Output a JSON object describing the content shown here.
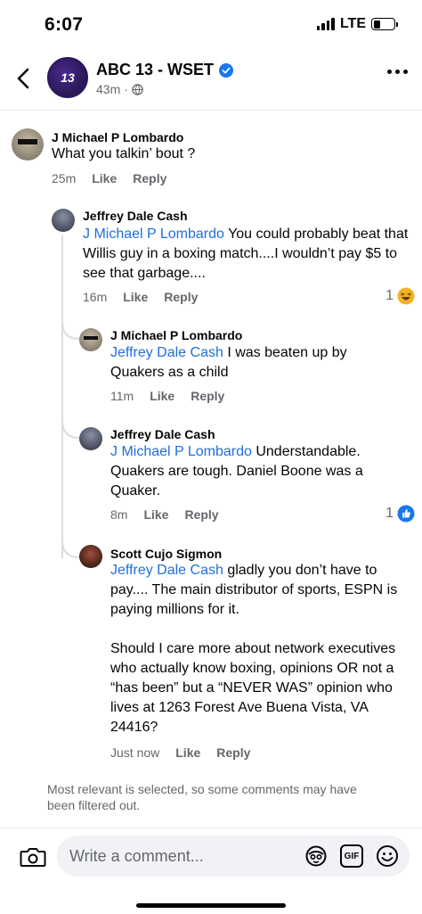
{
  "status_bar": {
    "time": "6:07",
    "network": "LTE",
    "battery_level": 0.35
  },
  "header": {
    "page_name": "ABC 13 - WSET",
    "post_time": "43m",
    "avatar_text": "13"
  },
  "comments": [
    {
      "author": "J Michael P Lombardo",
      "text": "What you talkin’ bout ?",
      "time": "25m",
      "like": "Like",
      "reply": "Reply"
    },
    {
      "author": "Jeffrey Dale Cash",
      "mention": "J Michael P Lombardo",
      "text": " You could probably beat that Willis guy in a boxing match....I wouldn’t pay $5 to see that garbage....",
      "time": "16m",
      "like": "Like",
      "reply": "Reply",
      "reaction_count": "1",
      "reaction_icon": "haha-emoji-icon"
    },
    {
      "author": "J Michael P Lombardo",
      "mention": "Jeffrey Dale Cash",
      "text": " I was beaten up by Quakers as a child",
      "time": "11m",
      "like": "Like",
      "reply": "Reply"
    },
    {
      "author": "Jeffrey Dale Cash",
      "mention": "J Michael P Lombardo",
      "text": " Understandable. Quakers are tough. Daniel Boone was a Quaker.",
      "time": "8m",
      "like": "Like",
      "reply": "Reply",
      "reaction_count": "1",
      "reaction_icon": "like-thumb-icon"
    },
    {
      "author": "Scott Cujo Sigmon",
      "mention": "Jeffrey Dale Cash",
      "text": " gladly you don’t have to pay.... The main distributor of sports, ESPN is paying millions for it.",
      "text2": "Should I care more about network executives who actually know boxing, opinions OR not a “has been” but a “NEVER WAS” opinion who lives at 1263 Forest Ave Buena Vista, VA 24416?",
      "time": "Just now",
      "like": "Like",
      "reply": "Reply"
    }
  ],
  "footer_note": "Most relevant is selected, so some comments may have been filtered out.",
  "composer": {
    "placeholder": "Write a comment...",
    "gif_label": "GIF"
  },
  "colors": {
    "mention": "#216fdb",
    "verified": "#1877f2",
    "secondary_text": "#65676b"
  }
}
